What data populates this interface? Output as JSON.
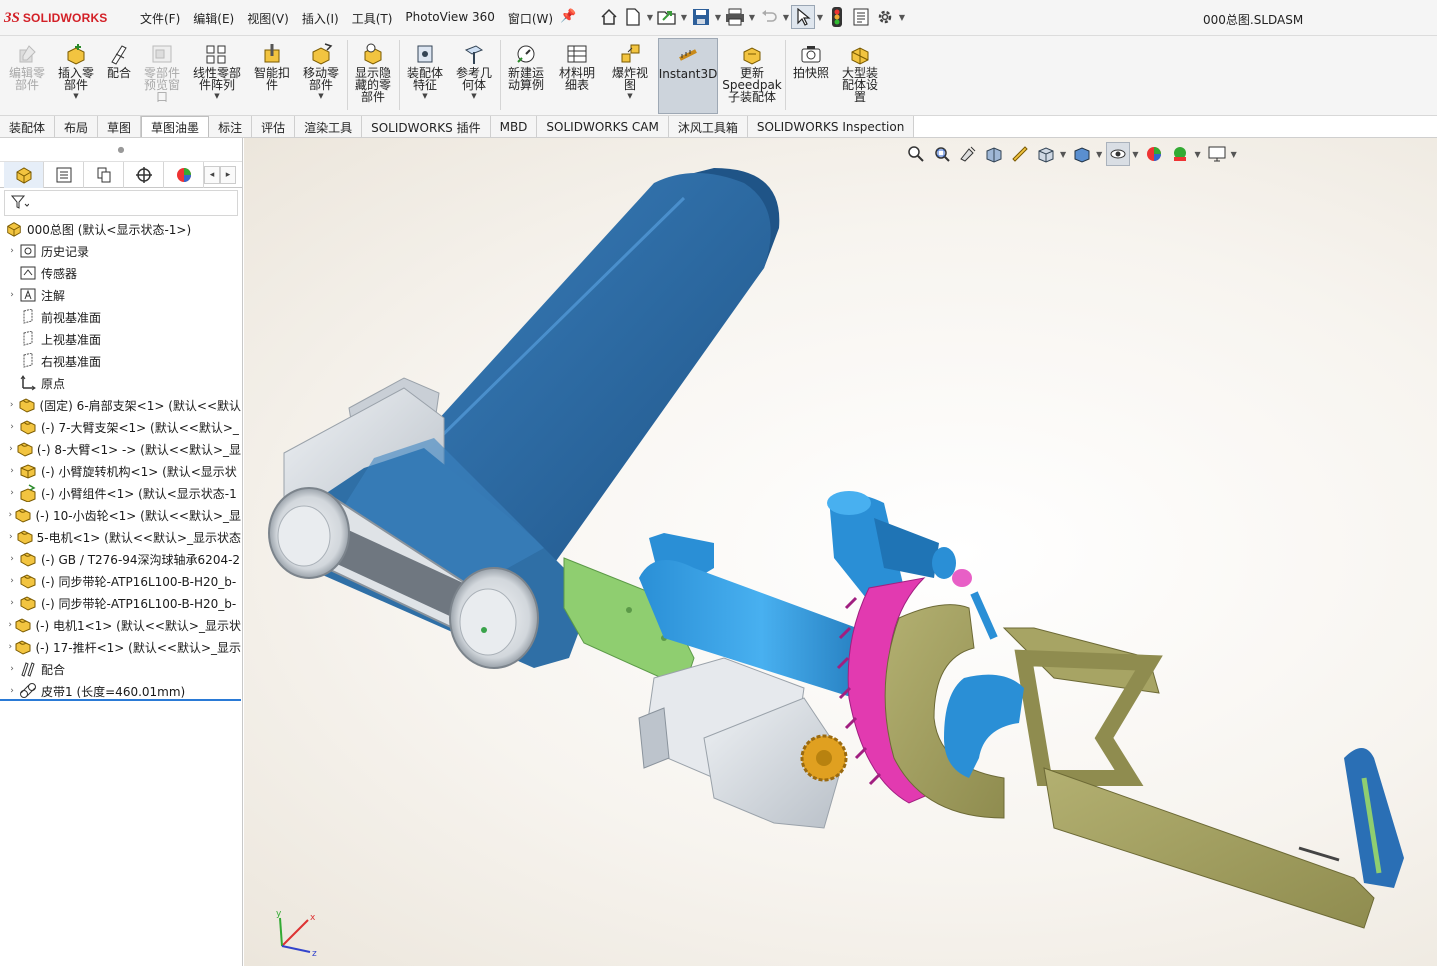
{
  "app": {
    "logo_mark": "3S",
    "logo_name": "SOLIDWORKS",
    "document_title": "000总图.SLDASM"
  },
  "menu": [
    "文件(F)",
    "编辑(E)",
    "视图(V)",
    "插入(I)",
    "工具(T)",
    "PhotoView 360",
    "窗口(W)"
  ],
  "quick_access": [
    "home-icon",
    "new-document-icon",
    "open-icon",
    "save-icon",
    "print-icon",
    "undo-icon",
    "select-arrow-icon",
    "traffic-light-icon",
    "file-properties-icon",
    "options-gear-icon"
  ],
  "ribbon": {
    "buttons": [
      {
        "label": "编辑零\n部件",
        "enabled": false,
        "icon": "edit-component-icon"
      },
      {
        "label": "插入零\n部件",
        "enabled": true,
        "icon": "insert-component-icon"
      },
      {
        "label": "配合",
        "enabled": true,
        "icon": "mate-icon"
      },
      {
        "label": "零部件\n预览窗\n口",
        "enabled": false,
        "icon": "component-preview-icon"
      },
      {
        "label": "线性零部\n件阵列",
        "enabled": true,
        "icon": "linear-pattern-icon"
      },
      {
        "label": "智能扣\n件",
        "enabled": true,
        "icon": "smart-fasteners-icon"
      },
      {
        "label": "移动零\n部件",
        "enabled": true,
        "icon": "move-component-icon"
      },
      {
        "label": "显示隐\n藏的零\n部件",
        "enabled": true,
        "icon": "show-hidden-icon"
      },
      {
        "label": "装配体\n特征",
        "enabled": true,
        "icon": "assembly-features-icon"
      },
      {
        "label": "参考几\n何体",
        "enabled": true,
        "icon": "reference-geometry-icon"
      },
      {
        "label": "新建运\n动算例",
        "enabled": true,
        "icon": "motion-study-icon"
      },
      {
        "label": "材料明\n细表",
        "enabled": true,
        "icon": "bom-icon"
      },
      {
        "label": "爆炸视\n图",
        "enabled": true,
        "icon": "exploded-view-icon"
      },
      {
        "label": "Instant3D",
        "enabled": true,
        "icon": "instant3d-icon"
      },
      {
        "label": "更新\nSpeedpak\n子装配体",
        "enabled": true,
        "icon": "speedpak-icon"
      },
      {
        "label": "拍快照",
        "enabled": true,
        "icon": "snapshot-icon"
      },
      {
        "label": "大型装\n配体设\n置",
        "enabled": true,
        "icon": "large-assembly-icon"
      }
    ]
  },
  "tabs": [
    "装配体",
    "布局",
    "草图",
    "草图油墨",
    "标注",
    "评估",
    "渲染工具",
    "SOLIDWORKS 插件",
    "MBD",
    "SOLIDWORKS CAM",
    "沐风工具箱",
    "SOLIDWORKS Inspection"
  ],
  "selected_tab": "草图油墨",
  "feature_tree": {
    "root": "000总图  (默认<显示状态-1>)",
    "items": [
      {
        "label": "历史记录",
        "icon": "history-icon",
        "expandable": true
      },
      {
        "label": "传感器",
        "icon": "sensor-icon",
        "expandable": false
      },
      {
        "label": "注解",
        "icon": "annotation-icon",
        "expandable": true
      },
      {
        "label": "前视基准面",
        "icon": "plane-icon",
        "expandable": false
      },
      {
        "label": "上视基准面",
        "icon": "plane-icon",
        "expandable": false
      },
      {
        "label": "右视基准面",
        "icon": "plane-icon",
        "expandable": false
      },
      {
        "label": "原点",
        "icon": "origin-icon",
        "expandable": false
      },
      {
        "label": "(固定) 6-肩部支架<1> (默认<<默认",
        "icon": "part-icon",
        "expandable": true
      },
      {
        "label": "(-) 7-大臂支架<1> (默认<<默认>_",
        "icon": "part-icon",
        "expandable": true
      },
      {
        "label": "(-) 8-大臂<1> -> (默认<<默认>_显",
        "icon": "part-icon",
        "expandable": true
      },
      {
        "label": "(-) 小臂旋转机构<1> (默认<显示状",
        "icon": "subassembly-icon",
        "expandable": true
      },
      {
        "label": "(-) 小臂组件<1> (默认<显示状态-1",
        "icon": "flexible-subassembly-icon",
        "expandable": true
      },
      {
        "label": "(-) 10-小齿轮<1> (默认<<默认>_显",
        "icon": "part-icon",
        "expandable": true
      },
      {
        "label": "5-电机<1> (默认<<默认>_显示状态",
        "icon": "part-icon",
        "expandable": true
      },
      {
        "label": "(-) GB / T276-94深沟球轴承6204-2",
        "icon": "part-icon",
        "expandable": true
      },
      {
        "label": "(-) 同步带轮-ATP16L100-B-H20_b-",
        "icon": "part-icon",
        "expandable": true
      },
      {
        "label": "(-) 同步带轮-ATP16L100-B-H20_b-",
        "icon": "part-icon",
        "expandable": true
      },
      {
        "label": "(-) 电机1<1> (默认<<默认>_显示状",
        "icon": "part-icon",
        "expandable": true
      },
      {
        "label": "(-) 17-推杆<1> (默认<<默认>_显示",
        "icon": "part-icon",
        "expandable": true
      },
      {
        "label": "配合",
        "icon": "mates-folder-icon",
        "expandable": true
      },
      {
        "label": "皮带1 (长度=460.01mm)",
        "icon": "belt-icon",
        "expandable": true
      }
    ]
  },
  "heads_up_toolbar": [
    "zoom-to-fit-icon",
    "zoom-area-icon",
    "previous-view-icon",
    "section-view-icon",
    "dynamic-annotation-icon",
    "view-orientation-icon",
    "display-style-icon",
    "hide-show-icon",
    "edit-appearance-icon",
    "apply-scene-icon",
    "view-settings-icon"
  ],
  "triad": {
    "x": "x",
    "y": "y",
    "z": "z"
  },
  "colors": {
    "arm_blue": "#2f6fa6",
    "cyan_part": "#2a8fd6",
    "light_gray": "#d9dde2",
    "green_link": "#8fce70",
    "magenta_gear": "#e23ab0",
    "olive_frame": "#a7a464",
    "gold_gear": "#e0a020",
    "accent": "#2a7ad6"
  }
}
